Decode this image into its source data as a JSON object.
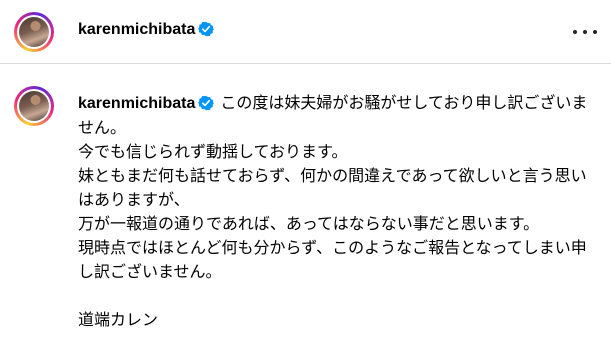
{
  "header": {
    "username": "karenmichibata",
    "verified": true,
    "more_icon": "more-horizontal-icon"
  },
  "post": {
    "username": "karenmichibata",
    "verified": true,
    "caption": "この度は妹夫婦がお騒がせしており申し訳ございません。\n今でも信じられず動揺しております。\n妹ともまだ何も話せておらず、何かの間違えであって欲しいと言う思いはありますが、\n万が一報道の通りであれば、あってはならない事だと思います。\n現時点ではほとんど何も分からず、このようなご報告となってしまい申し訳ございません。\n\n道端カレン"
  },
  "colors": {
    "verified_badge": "#0095f6",
    "divider": "#dbdbdb"
  }
}
